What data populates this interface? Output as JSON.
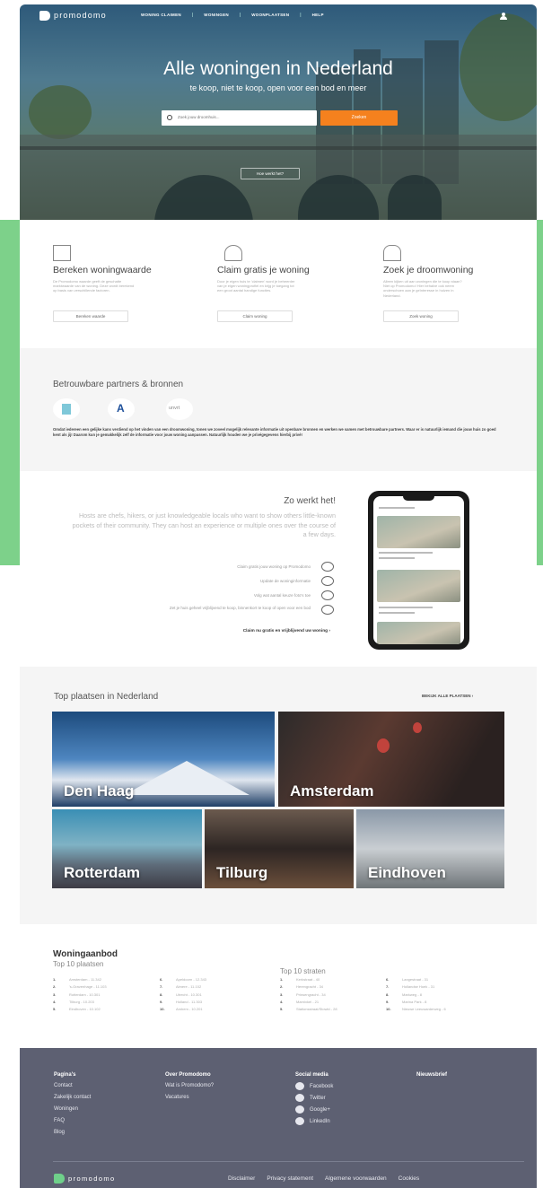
{
  "brand": {
    "name": "promodomo"
  },
  "nav": {
    "items": [
      "WONING CLAIMEN",
      "WONINGEN",
      "WOONPLAATSEN",
      "HELP"
    ]
  },
  "hero": {
    "title": "Alle woningen in Nederland",
    "subtitle": "te koop, niet te koop, open voor een bod en meer",
    "search_placeholder": "Zoek jouw droomhuis...",
    "search_button": "Zoeken",
    "how_button": "Hoe werkt het?"
  },
  "features": [
    {
      "icon": "house-chart-icon",
      "title": "Bereken woningwaarde",
      "text": "De Promodomo waarde geeft de geschatte marktwaarde van de woning. Deze wordt berekend op basis van verschillende factoren.",
      "button": "Bereken waarde"
    },
    {
      "icon": "person-house-icon",
      "title": "Claim gratis je woning",
      "text": "Door je eigen huis te 'claimen' word je beheerder van je eigen woningprofiel en krijg je toegang tot een groot aantal handige functies.",
      "button": "Claim woning"
    },
    {
      "icon": "home-outline-icon",
      "title": "Zoek je droomwoning",
      "text": "Alleen kijken uit aan woningen die te koop staan? Niet op Promodomo! Hier behalve ook neem onderschoen aan je geïnteresse in huizen in Nederland.",
      "button": "Zoek woning"
    }
  ],
  "partners": {
    "title": "Betrouwbare partners & bronnen",
    "logos": [
      "kadaster-logo",
      "a-logo",
      "unvrt-logo"
    ],
    "logo3_text": "unvrt",
    "text": "Omdat iedereen een gelijke kans verdiend op het vinden van een droomwoning, tonen we zoveel mogelijk relevante informatie uit openbare bronnen en werken we samen met betrouwbare partners. Waar er is natuurlijk iemand die jouw huis zo goed kent als jij! Daarom kun je gemakkelijk zelf de informatie voor jouw woning aanpassen. Natuurlijk houden we je privégegevens hierbij privé!"
  },
  "how": {
    "title": "Zo werkt het!",
    "text": "Hosts are chefs, hikers, or just knowledgeable locals who want to show others little-known pockets of their community. They can host an experience or multiple ones over the course of a few days.",
    "steps": [
      "Claim gratis jouw woning op Promodomo",
      "Update de woninginformatie",
      "Volg wat aantal keuze foto's toe",
      "Zet je huis geheel vrijblijvend te koop, binnenkort te koop of open voor een bod"
    ],
    "link": "Claim nu gratis en vrijblijvend uw woning"
  },
  "places": {
    "title": "Top plaatsen in Nederland",
    "link": "BEKIJK ALLE PLAATSEN",
    "tiles": [
      "Den Haag",
      "Amsterdam",
      "Rotterdam",
      "Tilburg",
      "Eindhoven"
    ]
  },
  "aanbod": {
    "title": "Woningaanbod",
    "sub_left": "Top 10 plaatsen",
    "sub_right": "Top 10 straten",
    "col1": [
      {
        "n": "1.",
        "t": "Amsterdam - 11.342"
      },
      {
        "n": "2.",
        "t": "'s-Gravenhage - 11.103"
      },
      {
        "n": "3.",
        "t": "Rotterdam - 10.301"
      },
      {
        "n": "4.",
        "t": "Tilburg - 10.203"
      },
      {
        "n": "5.",
        "t": "Eindhoven - 10.102"
      }
    ],
    "col2": [
      {
        "n": "6.",
        "t": "Apeldoorn - 12.343"
      },
      {
        "n": "7.",
        "t": "Almere - 11.102"
      },
      {
        "n": "8.",
        "t": "Utrecht - 10.301"
      },
      {
        "n": "9.",
        "t": "Holland - 11.303"
      },
      {
        "n": "10.",
        "t": "Amhem - 10.201"
      }
    ],
    "col3": [
      {
        "n": "1.",
        "t": "Kerkstraat - 40"
      },
      {
        "n": "2.",
        "t": "Herengracht - 34"
      },
      {
        "n": "3.",
        "t": "Prinsengracht - 34"
      },
      {
        "n": "4.",
        "t": "Marnixkel - 21"
      },
      {
        "n": "5.",
        "t": "Stationsstraat/Stowld - 28"
      }
    ],
    "col4": [
      {
        "n": "6.",
        "t": "Langestraat - 31"
      },
      {
        "n": "7.",
        "t": "Hollandse Hoek - 31"
      },
      {
        "n": "8.",
        "t": "Markweg - 8"
      },
      {
        "n": "9.",
        "t": "Marina Park - 8"
      },
      {
        "n": "10.",
        "t": "Nieuwe Leeuwarderweg - 6"
      }
    ]
  },
  "footer": {
    "col1": {
      "head": "Pagina's",
      "items": [
        "Contact",
        "Zakelijk contact",
        "Woningen",
        "FAQ",
        "Blog"
      ]
    },
    "col2": {
      "head": "Over Promodomo",
      "items": [
        "Wat is Promodomo?",
        "Vacatures"
      ]
    },
    "col3": {
      "head": "Social media",
      "items": [
        "Facebook",
        "Twitter",
        "Google+",
        "LinkedIn"
      ]
    },
    "col4": {
      "head": "Nieuwsbrief"
    },
    "bottom_links": [
      "Disclaimer",
      "Privacy statement",
      "Algemene voorwaarden",
      "Cookies"
    ]
  },
  "colors": {
    "accent": "#f5811e",
    "green": "#7dd18a",
    "footer": "#5d6072"
  }
}
